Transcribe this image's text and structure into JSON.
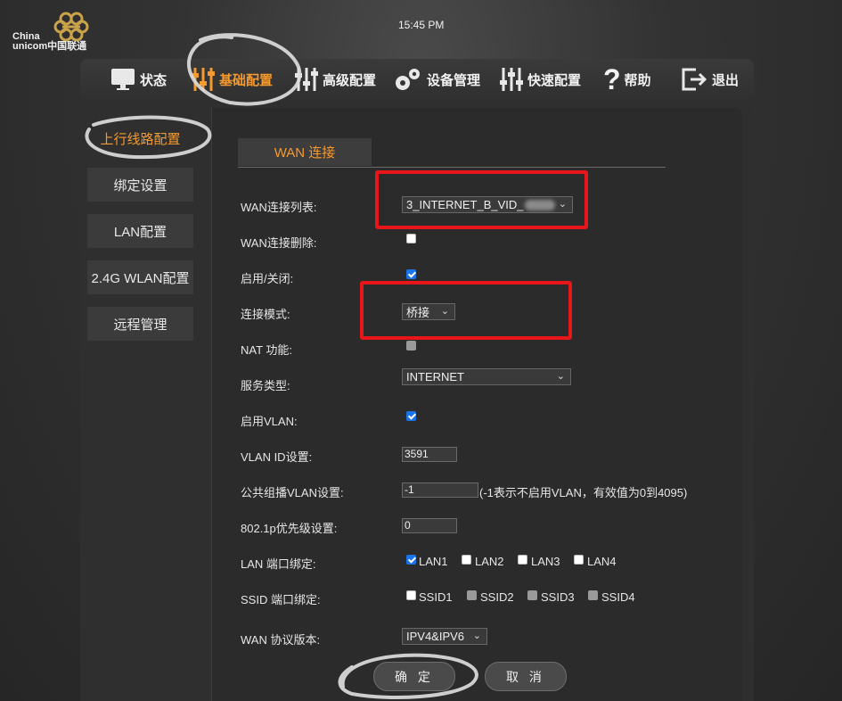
{
  "brand": {
    "logo_line1": "China",
    "logo_line2": "unicom中国联通"
  },
  "clock": "15:45 PM",
  "nav": {
    "items": [
      {
        "label": "状态",
        "icon": "monitor-icon"
      },
      {
        "label": "基础配置",
        "icon": "sliders-icon",
        "active": true
      },
      {
        "label": "高级配置",
        "icon": "sliders-icon"
      },
      {
        "label": "设备管理",
        "icon": "gears-icon"
      },
      {
        "label": "快速配置",
        "icon": "sliders-icon"
      },
      {
        "label": "帮助",
        "icon": "question-icon"
      },
      {
        "label": "退出",
        "icon": "logout-icon"
      }
    ]
  },
  "sidebar": {
    "items": [
      {
        "label": "上行线路配置",
        "active": true
      },
      {
        "label": "绑定设置"
      },
      {
        "label": "LAN配置"
      },
      {
        "label": "2.4G WLAN配置"
      },
      {
        "label": "远程管理"
      }
    ]
  },
  "tab": {
    "label": "WAN 连接"
  },
  "form": {
    "wan_list": {
      "label": "WAN连接列表:",
      "value": "3_INTERNET_B_VID_"
    },
    "wan_delete": {
      "label": "WAN连接删除:",
      "checked": false
    },
    "enable": {
      "label": "启用/关闭:",
      "checked": true
    },
    "mode": {
      "label": "连接模式:",
      "value": "桥接"
    },
    "nat": {
      "label": "NAT 功能:",
      "checked": false,
      "disabled": true
    },
    "service": {
      "label": "服务类型:",
      "value": "INTERNET"
    },
    "vlan_enable": {
      "label": "启用VLAN:",
      "checked": true
    },
    "vlan_id": {
      "label": "VLAN ID设置:",
      "value": "3591"
    },
    "mcast_vlan": {
      "label": "公共组播VLAN设置:",
      "value": "-1",
      "hint": "(-1表示不启用VLAN，有效值为0到4095)"
    },
    "priority": {
      "label": "802.1p优先级设置:",
      "value": "0"
    },
    "lan_bind": {
      "label": "LAN 端口绑定:",
      "options": [
        {
          "label": "LAN1",
          "checked": true
        },
        {
          "label": "LAN2",
          "checked": false
        },
        {
          "label": "LAN3",
          "checked": false
        },
        {
          "label": "LAN4",
          "checked": false
        }
      ]
    },
    "ssid_bind": {
      "label": "SSID 端口绑定:",
      "options": [
        {
          "label": "SSID1",
          "checked": false
        },
        {
          "label": "SSID2",
          "checked": false,
          "disabled": true
        },
        {
          "label": "SSID3",
          "checked": false,
          "disabled": true
        },
        {
          "label": "SSID4",
          "checked": false,
          "disabled": true
        }
      ]
    },
    "ip_version": {
      "label": "WAN 协议版本:",
      "value": "IPV4&IPV6"
    }
  },
  "buttons": {
    "confirm": "确 定",
    "cancel": "取 消"
  },
  "colors": {
    "accent": "#f59a2e",
    "annotation_red": "#e8151b",
    "checkbox_blue": "#1a73e8"
  }
}
